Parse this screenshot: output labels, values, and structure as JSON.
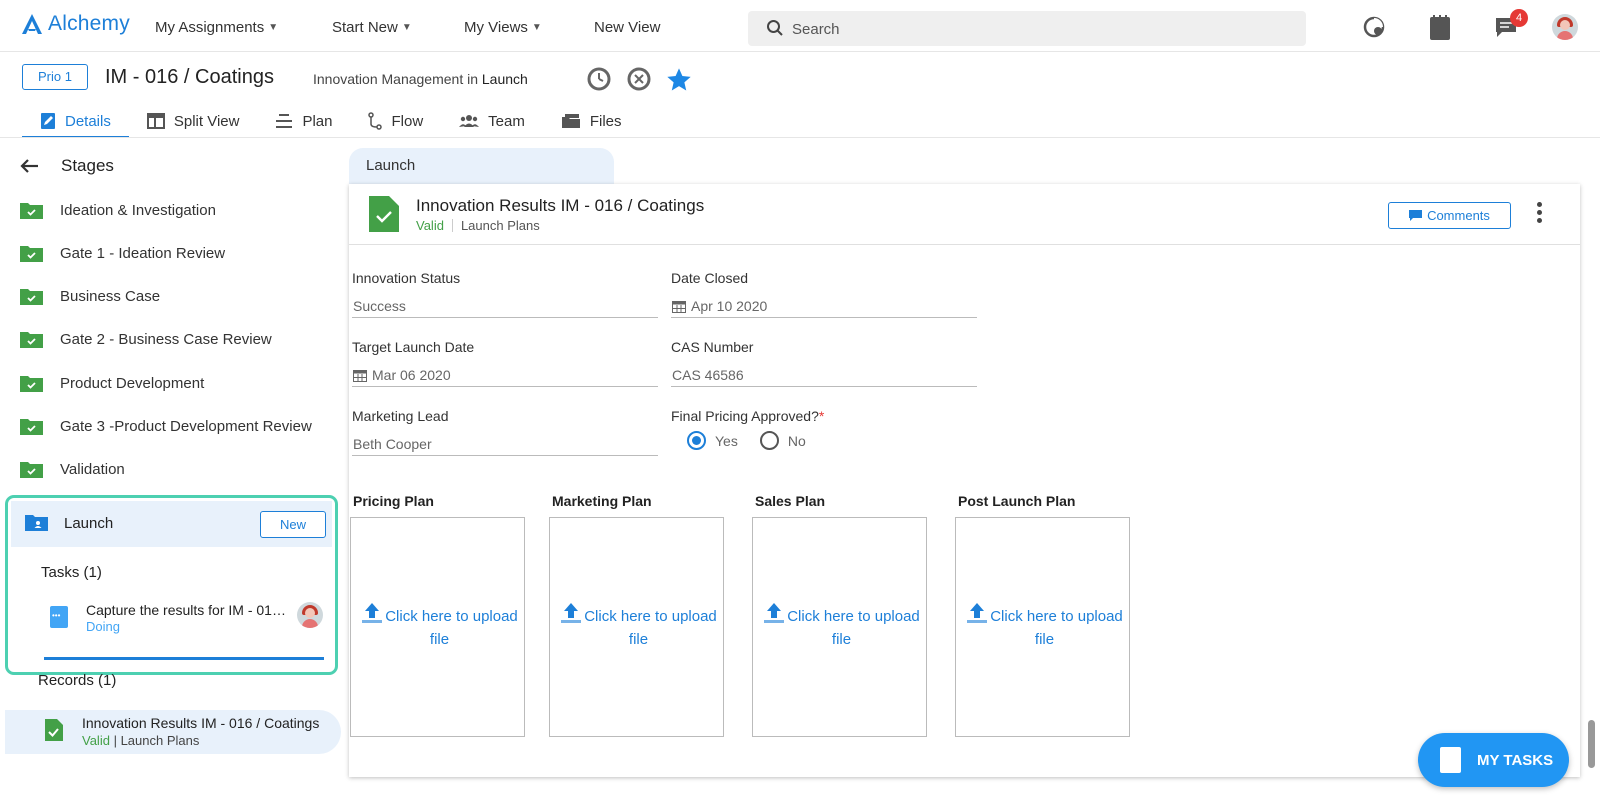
{
  "topnav": {
    "brand": "Alchemy",
    "items": [
      {
        "label": "My Assignments"
      },
      {
        "label": "Start New"
      },
      {
        "label": "My Views"
      },
      {
        "label": "New View"
      }
    ],
    "search_placeholder": "Search",
    "notification_count": "4"
  },
  "header": {
    "priority": "Prio 1",
    "title": "IM - 016 / Coatings",
    "subtitle_prefix": "Innovation Management in",
    "subtitle_stage": "Launch"
  },
  "tabs": [
    {
      "label": "Details",
      "active": true
    },
    {
      "label": "Split View"
    },
    {
      "label": "Plan"
    },
    {
      "label": "Flow"
    },
    {
      "label": "Team"
    },
    {
      "label": "Files"
    }
  ],
  "sidebar": {
    "title": "Stages",
    "stages": [
      {
        "label": "Ideation & Investigation"
      },
      {
        "label": "Gate 1 - Ideation Review"
      },
      {
        "label": "Business Case"
      },
      {
        "label": "Gate 2 - Business Case Review"
      },
      {
        "label": "Product Development"
      },
      {
        "label": "Gate 3 -Product Development Review"
      },
      {
        "label": "Validation"
      }
    ],
    "current_stage": {
      "label": "Launch",
      "new_button": "New",
      "tasks_heading": "Tasks (1)",
      "task": {
        "title": "Capture the results for IM - 016 / Coatings",
        "status": "Doing"
      }
    },
    "records_heading": "Records (1)",
    "record": {
      "title": "Innovation Results IM - 016 / Coatings",
      "status": "Valid",
      "type": "| Launch Plans"
    }
  },
  "main": {
    "stage_tab": "Launch",
    "record_title": "Innovation Results IM - 016 / Coatings",
    "record_status": "Valid",
    "record_type": "Launch Plans",
    "comments_button": "Comments",
    "fields": {
      "innovation_status": {
        "label": "Innovation Status",
        "value": "Success"
      },
      "date_closed": {
        "label": "Date Closed",
        "value": "Apr 10 2020"
      },
      "target_launch_date": {
        "label": "Target Launch Date",
        "value": "Mar 06 2020"
      },
      "cas_number": {
        "label": "CAS Number",
        "value": "CAS 46586"
      },
      "marketing_lead": {
        "label": "Marketing Lead",
        "value": "Beth Cooper"
      },
      "final_pricing": {
        "label": "Final Pricing Approved?",
        "required_mark": "*",
        "options": [
          "Yes",
          "No"
        ],
        "selected": "Yes"
      }
    },
    "plans": [
      {
        "label": "Pricing Plan",
        "upload_text": "Click here to upload file"
      },
      {
        "label": "Marketing Plan",
        "upload_text": "Click here to upload file"
      },
      {
        "label": "Sales Plan",
        "upload_text": "Click here to upload file"
      },
      {
        "label": "Post Launch Plan",
        "upload_text": "Click here to upload file"
      }
    ]
  },
  "my_tasks_button": "MY TASKS",
  "colors": {
    "accent": "#1d7fd8",
    "success": "#43a047",
    "highlight_border": "#4dd0b1",
    "badge": "#e53935"
  }
}
